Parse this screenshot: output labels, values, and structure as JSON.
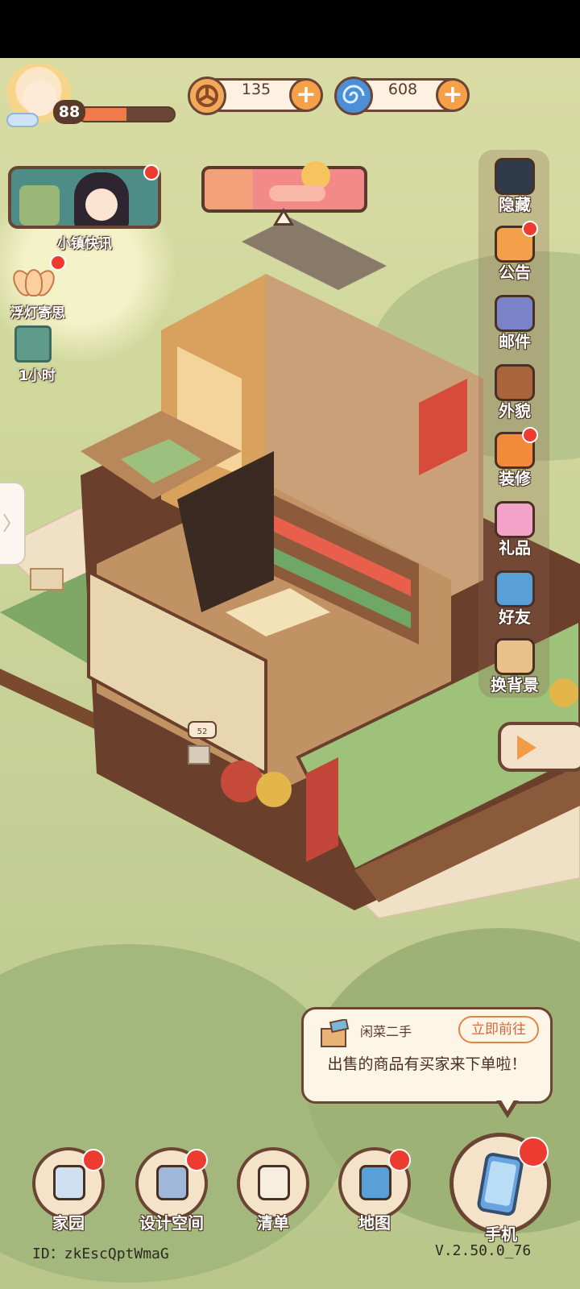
{
  "hud": {
    "level": "88",
    "level_progress": 0.5,
    "coins": "135",
    "gems": "608",
    "plus": "+"
  },
  "left_panel": {
    "news_label": "小镇快讯",
    "lantern_label": "浮灯寄思",
    "timer_label": "1小时",
    "side_tab_glyph": "〉"
  },
  "right_menu": [
    {
      "label": "隐藏",
      "icon": "hide-frame-icon"
    },
    {
      "label": "公告",
      "icon": "announcement-horn-icon"
    },
    {
      "label": "邮件",
      "icon": "mail-envelope-icon"
    },
    {
      "label": "外貌",
      "icon": "appearance-face-icon"
    },
    {
      "label": "装修",
      "icon": "decorate-house-icon"
    },
    {
      "label": "礼品",
      "icon": "gift-box-icon"
    },
    {
      "label": "好友",
      "icon": "friends-book-icon"
    },
    {
      "label": "换背景",
      "icon": "background-change-icon"
    }
  ],
  "scene": {
    "sign_number": "52"
  },
  "notification": {
    "title": "闲菜二手",
    "action": "立即前往",
    "message": "出售的商品有买家来下单啦！"
  },
  "bottom_nav": [
    {
      "label": "家园",
      "icon": "home-icon"
    },
    {
      "label": "设计空间",
      "icon": "design-space-icon"
    },
    {
      "label": "清单",
      "icon": "checklist-icon"
    },
    {
      "label": "地图",
      "icon": "map-pin-icon"
    }
  ],
  "phone": {
    "label": "手机"
  },
  "footer": {
    "id_text": "ID：zkEscQptWmaG",
    "version": "V.2.50.0_76"
  },
  "colors": {
    "brown_border": "#6b4434",
    "accent_orange": "#f7a04a",
    "alert_red": "#ee3b2f",
    "sky_green": "#cdd69a"
  }
}
